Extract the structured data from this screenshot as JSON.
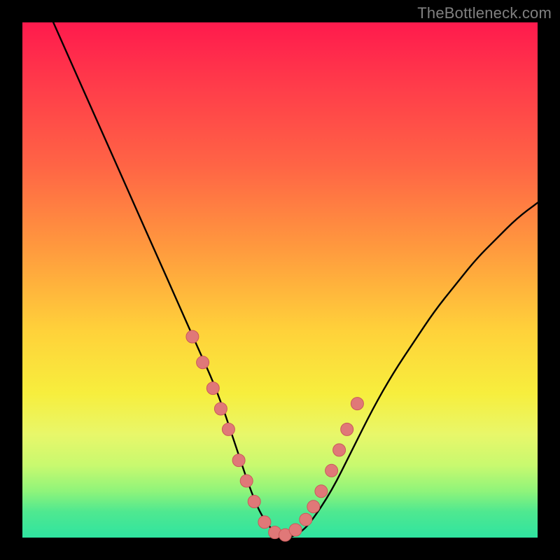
{
  "watermark": "TheBottleneck.com",
  "colors": {
    "background": "#000000",
    "gradient_top": "#ff1a4d",
    "gradient_mid": "#ffd23a",
    "gradient_bottom": "#2fe4a0",
    "curve": "#000000",
    "marker_fill": "#e07878",
    "marker_stroke": "#c95a5a"
  },
  "chart_data": {
    "type": "line",
    "title": "",
    "xlabel": "",
    "ylabel": "",
    "xlim": [
      0,
      100
    ],
    "ylim": [
      0,
      100
    ],
    "series": [
      {
        "name": "bottleneck-curve",
        "x": [
          6,
          10,
          14,
          18,
          22,
          26,
          30,
          34,
          38,
          42,
          44,
          46,
          48,
          50,
          52,
          54,
          56,
          60,
          64,
          68,
          72,
          76,
          80,
          84,
          88,
          92,
          96,
          100
        ],
        "y": [
          100,
          91,
          82,
          73,
          64,
          55,
          46,
          37,
          28,
          16,
          10,
          5,
          2,
          0,
          0,
          1,
          3,
          9,
          17,
          25,
          32,
          38,
          44,
          49,
          54,
          58,
          62,
          65
        ]
      }
    ],
    "markers": {
      "name": "highlight-points",
      "x": [
        33,
        35,
        37,
        38.5,
        40,
        42,
        43.5,
        45,
        47,
        49,
        51,
        53,
        55,
        56.5,
        58,
        60,
        61.5,
        63,
        65
      ],
      "y": [
        39,
        34,
        29,
        25,
        21,
        15,
        11,
        7,
        3,
        1,
        0.5,
        1.5,
        3.5,
        6,
        9,
        13,
        17,
        21,
        26
      ]
    }
  }
}
